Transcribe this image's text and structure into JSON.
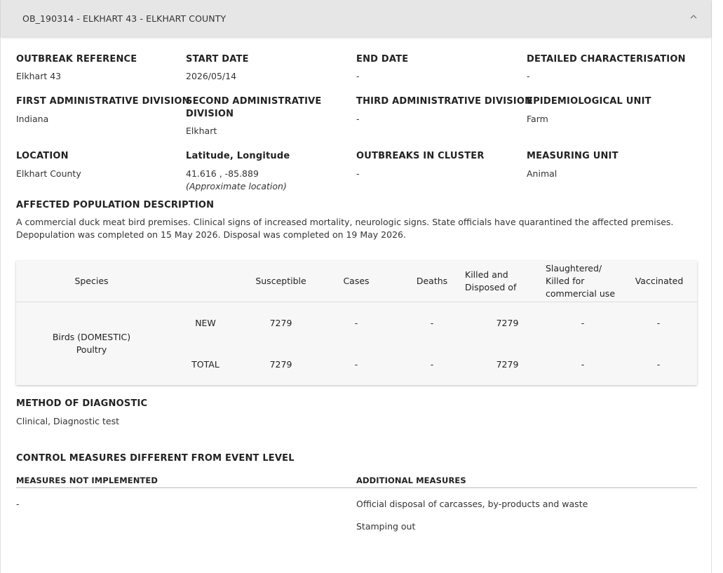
{
  "header": {
    "title": "OB_190314 - ELKHART 43 - ELKHART COUNTY"
  },
  "fields": {
    "outbreak_reference": {
      "label": "OUTBREAK REFERENCE",
      "value": "Elkhart 43"
    },
    "start_date": {
      "label": "START DATE",
      "value": "2026/05/14"
    },
    "end_date": {
      "label": "END DATE",
      "value": "-"
    },
    "detailed_characterisation": {
      "label": "DETAILED CHARACTERISATION",
      "value": "-"
    },
    "first_admin": {
      "label": "FIRST ADMINISTRATIVE DIVISION",
      "value": "Indiana"
    },
    "second_admin": {
      "label_line1": "SECOND ADMINISTRATIVE",
      "label_line2": "DIVISION",
      "value": "Elkhart"
    },
    "third_admin": {
      "label": "THIRD ADMINISTRATIVE DIVISION",
      "value": "-"
    },
    "epi_unit": {
      "label": "EPIDEMIOLOGICAL UNIT",
      "value": "Farm"
    },
    "location": {
      "label": "LOCATION",
      "value": "Elkhart County"
    },
    "lat_long": {
      "label": "Latitude, Longitude",
      "value": "41.616 , -85.889",
      "note": "(Approximate location)"
    },
    "outbreaks_in_cluster": {
      "label": "OUTBREAKS IN CLUSTER",
      "value": "-"
    },
    "measuring_unit": {
      "label": "MEASURING UNIT",
      "value": "Animal"
    }
  },
  "affected_population": {
    "label": "AFFECTED POPULATION DESCRIPTION",
    "line1": "A commercial duck meat bird premises. Clinical signs of increased mortality, neurologic signs. State officials have quarantined the affected premises.",
    "line2": "Depopulation was completed on 15 May 2026. Disposal was completed on 19 May 2026."
  },
  "table": {
    "headers": {
      "species": "Species",
      "susceptible": "Susceptible",
      "cases": "Cases",
      "deaths": "Deaths",
      "killed_l1": "Killed and",
      "killed_l2": "Disposed of",
      "slaughtered_l1": "Slaughtered/",
      "slaughtered_l2": "Killed for",
      "slaughtered_l3": "commercial use",
      "vaccinated": "Vaccinated"
    },
    "species_line1": "Birds (DOMESTIC)",
    "species_line2": "Poultry",
    "rows": [
      {
        "type": "NEW",
        "susceptible": "7279",
        "cases": "-",
        "deaths": "-",
        "killed": "7279",
        "slaughtered": "-",
        "vaccinated": "-"
      },
      {
        "type": "TOTAL",
        "susceptible": "7279",
        "cases": "-",
        "deaths": "-",
        "killed": "7279",
        "slaughtered": "-",
        "vaccinated": "-"
      }
    ]
  },
  "method_of_diagnostic": {
    "label": "METHOD OF DIAGNOSTIC",
    "value": "Clinical, Diagnostic test"
  },
  "control_measures": {
    "title": "CONTROL MEASURES DIFFERENT FROM EVENT LEVEL",
    "not_implemented_label": "MEASURES NOT IMPLEMENTED",
    "not_implemented_value": "-",
    "additional_label": "ADDITIONAL MEASURES",
    "additional_items": [
      "Official disposal of carcasses, by-products and waste",
      "Stamping out"
    ]
  }
}
